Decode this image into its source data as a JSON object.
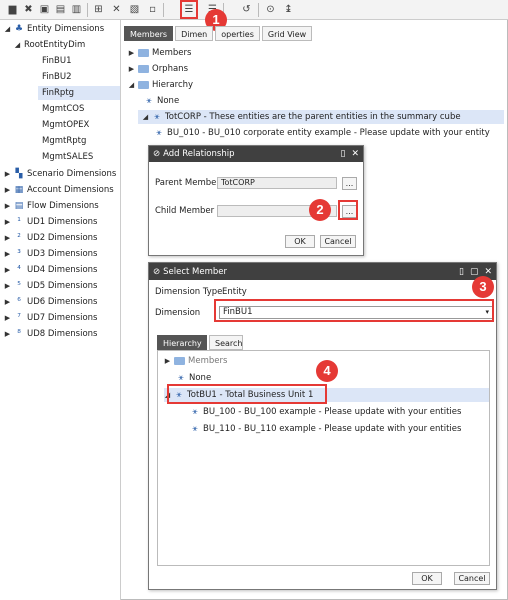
{
  "toolbar": {
    "icons": [
      "open-icon",
      "delete-icon",
      "save-icon",
      "copy-icon",
      "cut-icon",
      "sep",
      "insert-icon",
      "close-icon",
      "new-icon",
      "save2-icon",
      "sep",
      "add-relationship-icon",
      "remove-relationship-icon",
      "sep",
      "undo-icon",
      "sep",
      "search-icon",
      "expand-icon"
    ]
  },
  "left_tree": {
    "root_label": "Entity Dimensions",
    "dim_label": "RootEntityDim",
    "entities": [
      "FinBU1",
      "FinBU2",
      "FinRptg",
      "MgmtCOS",
      "MgmtOPEX",
      "MgmtRptg",
      "MgmtSALES"
    ],
    "dimensions": [
      "Scenario Dimensions",
      "Account Dimensions",
      "Flow Dimensions",
      "UD1 Dimensions",
      "UD2 Dimensions",
      "UD3 Dimensions",
      "UD4 Dimensions",
      "UD5 Dimensions",
      "UD6 Dimensions",
      "UD7 Dimensions",
      "UD8 Dimensions"
    ]
  },
  "tabs": {
    "members": "Members",
    "dimension": "Dimen",
    "properties": "operties",
    "gridview": "Grid View"
  },
  "right_tree": {
    "members": "Members",
    "orphans": "Orphans",
    "hierarchy": "Hierarchy",
    "none": "None",
    "totcorp": "TotCORP - These entities are the parent entities in the summary cube",
    "bu010": "BU_010 - BU_010 corporate entity example - Please update with your entity"
  },
  "add_relationship": {
    "title": "Add Relationship",
    "parent_label": "Parent Member",
    "parent_value": "TotCORP",
    "child_label": "Child Member",
    "child_value": "",
    "browse": "...",
    "ok": "OK",
    "cancel": "Cancel"
  },
  "select_member": {
    "title": "Select Member",
    "dimtype_label": "Dimension Type",
    "dimtype_value": "Entity",
    "dimension_label": "Dimension",
    "dimension_value": "FinBU1",
    "tab_hierarchy": "Hierarchy",
    "tab_search": "Search",
    "members": "Members",
    "none": "None",
    "totbu1": "TotBU1 - Total Business Unit 1",
    "bu100": "BU_100 - BU_100 example - Please update with your entities",
    "bu110": "BU_110 - BU_110 example - Please update with your entities",
    "ok": "OK",
    "cancel": "Cancel"
  },
  "callouts": [
    "1",
    "2",
    "3",
    "4"
  ],
  "colors": {
    "accent": "#e53935",
    "title_bar": "#404040",
    "selection": "#dce6f7"
  }
}
